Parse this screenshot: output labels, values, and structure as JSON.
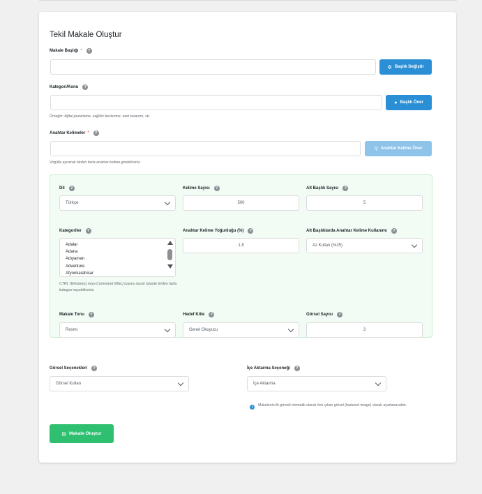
{
  "form": {
    "title": "Tekil Makale Oluştur",
    "article_title": {
      "label": "Makale Başlığı",
      "required_mark": "*",
      "value": "",
      "button": "Başlık Değiştir"
    },
    "category_topic": {
      "label": "Kategori/Konu",
      "value": "",
      "button": "Başlık Öner",
      "hint": "Örneğin: dijital pazarlama, sağlıklı beslenme, web tasarımı, vb."
    },
    "keywords": {
      "label": "Anahtar Kelimeler",
      "required_mark": "*",
      "value": "",
      "button": "Anahtar Kelime Öner",
      "hint": "Virgülle ayırarak birden fazla anahtar kelime girebilirsiniz."
    },
    "help_mark": "?"
  },
  "settings": {
    "language": {
      "label": "Dil",
      "value": "Türkçe"
    },
    "word_count": {
      "label": "Kelime Sayısı",
      "value": "500"
    },
    "subheading_count": {
      "label": "Alt Başlık Sayısı",
      "value": "5"
    },
    "categories": {
      "label": "Kategoriler",
      "options": [
        "Adalar",
        "Adana",
        "Adıyaman",
        "Adventure",
        "Afyonkarahisar"
      ],
      "hint": "CTRL (Windows) veya Command (Mac) tuşunu basılı tutarak birden fazla kategori seçebilirsiniz."
    },
    "keyword_density": {
      "label": "Anahtar Kelime Yoğunluğu (%)",
      "value": "1,5"
    },
    "subheading_keyword_usage": {
      "label": "Alt Başlıklarda Anahtar Kelime Kullanımı",
      "value": "Az Kullan (%25)"
    },
    "tone": {
      "label": "Makale Tonu",
      "value": "Resmi"
    },
    "audience": {
      "label": "Hedef Kitle",
      "value": "Genel Okuyucu"
    },
    "image_count": {
      "label": "Görsel Sayısı",
      "value": "3"
    }
  },
  "image_options": {
    "label": "Görsel Seçenekleri",
    "value": "Görsel Kullan"
  },
  "import_option": {
    "label": "İçe Aktarma Seçeneği",
    "value": "İçe Aktarma"
  },
  "info_note": "Makalenin ilk görseli otomatik olarak öne çıkan görsel (featured image) olarak ayarlanacaktır.",
  "submit_label": "Makale Oluştur",
  "colors": {
    "primary": "#2b8fd6",
    "primary_light": "#8ec3ea",
    "success": "#2fbf71",
    "panel_bg": "#f3fcf4",
    "required": "#d63638"
  }
}
